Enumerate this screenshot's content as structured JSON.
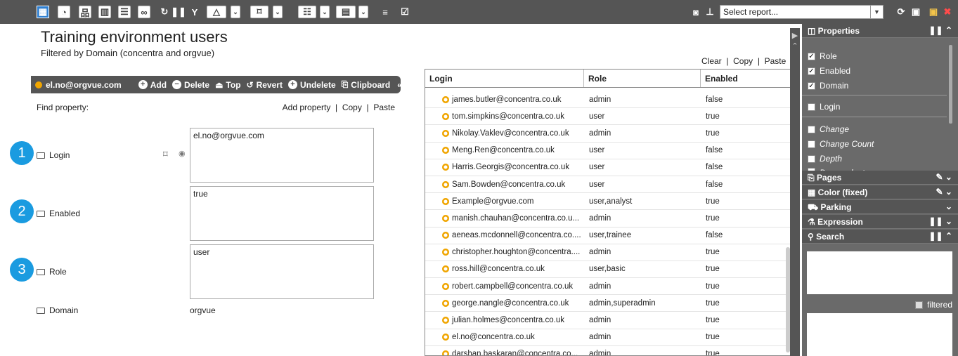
{
  "toolbar": {
    "report_select": "Select report...",
    "icons": [
      "table-icon",
      "chart-icon",
      "hierarchy-icon",
      "bar-chart-icon",
      "list-icon",
      "link-icon",
      "refresh-icon",
      "pause-icon",
      "filter-icon",
      "triangle-icon",
      "bookmark-icon",
      "indent-icon",
      "grid-icon",
      "menu-icon",
      "check-icon",
      "camera-icon",
      "pin-icon",
      "sync-icon",
      "save-as-icon",
      "save-icon",
      "close-icon"
    ]
  },
  "page": {
    "title": "Training environment users",
    "subtitle": "Filtered by Domain (concentra and orgvue)"
  },
  "form": {
    "selected_user": "el.no@orgvue.com",
    "actions": [
      "Add",
      "Delete",
      "Top",
      "Revert",
      "Undelete",
      "Clipboard"
    ],
    "find_label": "Find property:",
    "add_property": "Add property",
    "copy": "Copy",
    "paste": "Paste",
    "fields": [
      {
        "number": "1",
        "label": "Login",
        "value": "el.no@orgvue.com"
      },
      {
        "number": "2",
        "label": "Enabled",
        "value": "true"
      },
      {
        "number": "3",
        "label": "Role",
        "value": "user"
      }
    ],
    "domain_label": "Domain",
    "domain_value": "orgvue"
  },
  "grid": {
    "clear": "Clear",
    "copy": "Copy",
    "paste": "Paste",
    "columns": [
      "Login",
      "Role",
      "Enabled"
    ],
    "rows": [
      [
        "james.butler@concentra.co.uk",
        "admin",
        "false"
      ],
      [
        "tom.simpkins@concentra.co.uk",
        "user",
        "true"
      ],
      [
        "Nikolay.Vaklev@concentra.co.uk",
        "admin",
        "true"
      ],
      [
        "Meng.Ren@concentra.co.uk",
        "user",
        "false"
      ],
      [
        "Harris.Georgis@concentra.co.uk",
        "user",
        "false"
      ],
      [
        "Sam.Bowden@concentra.co.uk",
        "user",
        "false"
      ],
      [
        "Example@orgvue.com",
        "user,analyst",
        "true"
      ],
      [
        "manish.chauhan@concentra.co.u...",
        "admin",
        "true"
      ],
      [
        "aeneas.mcdonnell@concentra.co....",
        "user,trainee",
        "false"
      ],
      [
        "christopher.houghton@concentra....",
        "admin",
        "true"
      ],
      [
        "ross.hill@concentra.co.uk",
        "user,basic",
        "true"
      ],
      [
        "robert.campbell@concentra.co.uk",
        "admin",
        "true"
      ],
      [
        "george.nangle@concentra.co.uk",
        "admin,superadmin",
        "true"
      ],
      [
        "julian.holmes@concentra.co.uk",
        "admin",
        "true"
      ],
      [
        "el.no@concentra.co.uk",
        "admin",
        "true"
      ],
      [
        "darshan.baskaran@concentra.co...",
        "admin",
        "true"
      ]
    ]
  },
  "panel": {
    "properties": "Properties",
    "items": [
      {
        "label": "Role",
        "checked": true
      },
      {
        "label": "Enabled",
        "checked": true
      },
      {
        "label": "Domain",
        "checked": true
      },
      {
        "label": "Login",
        "checked": false
      },
      {
        "label": "Change",
        "checked": false
      },
      {
        "label": "Change Count",
        "checked": false
      },
      {
        "label": "Depth",
        "checked": false
      },
      {
        "label": "Descendants",
        "checked": false
      }
    ],
    "sections": [
      "Pages",
      "Color (fixed)",
      "Parking",
      "Expression",
      "Search"
    ],
    "filtered": "filtered"
  }
}
